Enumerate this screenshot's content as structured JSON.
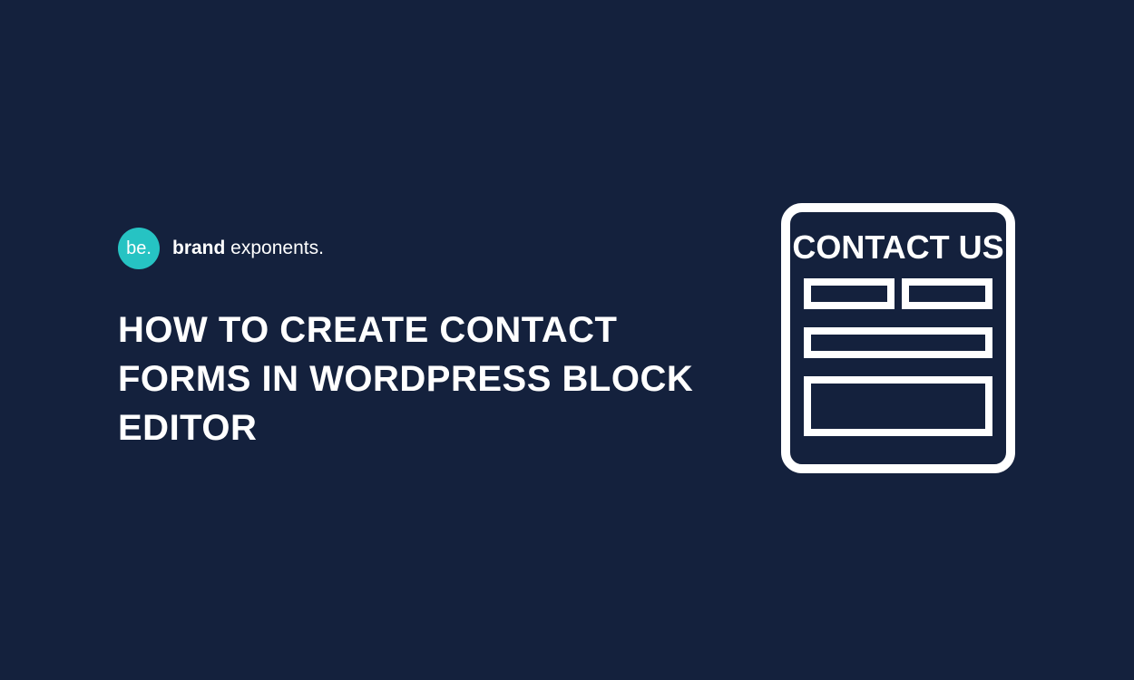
{
  "logo": {
    "badge": "be.",
    "bold": "brand",
    "light": " exponents."
  },
  "heading": "HOW TO CREATE CONTACT FORMS IN WORDPRESS BLOCK EDITOR",
  "illustration": {
    "title": "CONTACT US"
  }
}
